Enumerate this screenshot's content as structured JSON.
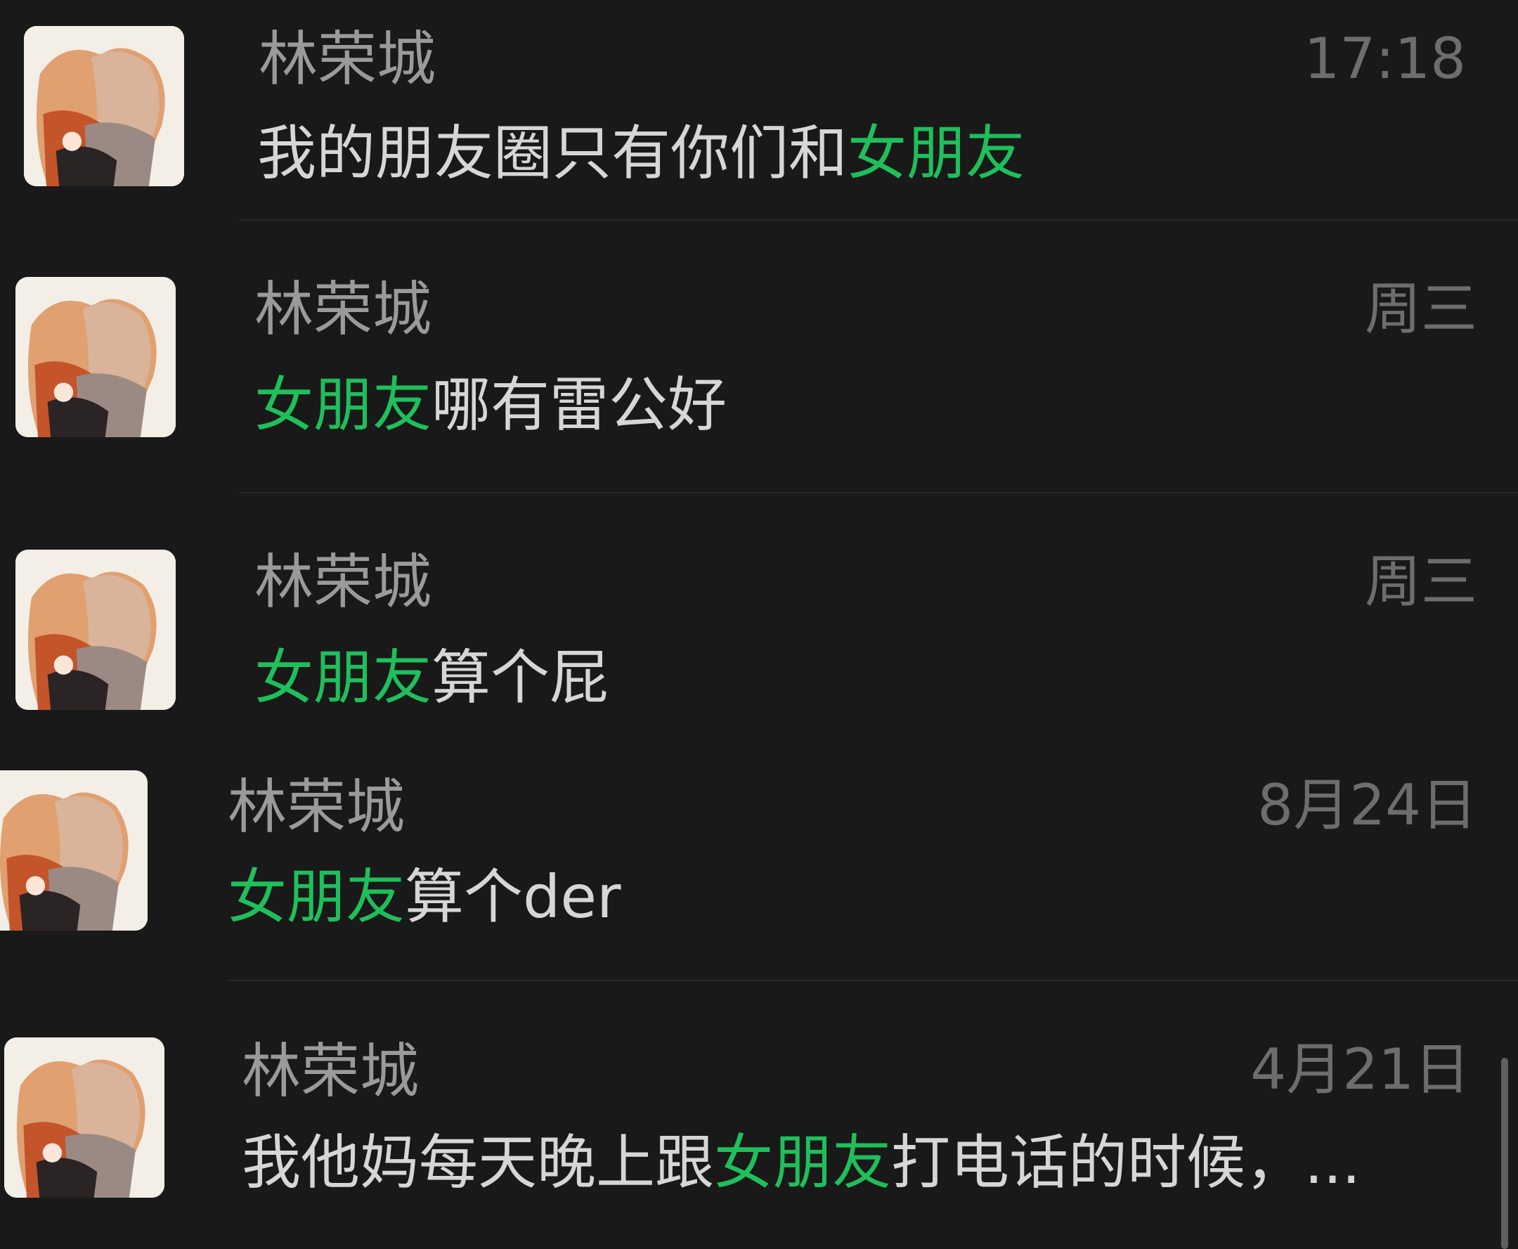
{
  "results": [
    {
      "name": "林荣城",
      "time": "17:18",
      "message": {
        "before": "我的朋友圈只有你们和",
        "highlight": "女朋友",
        "after": ""
      }
    },
    {
      "name": "林荣城",
      "time": "周三",
      "message": {
        "before": "",
        "highlight": "女朋友",
        "after": "哪有雷公好"
      }
    },
    {
      "name": "林荣城",
      "time": "周三",
      "message": {
        "before": "",
        "highlight": "女朋友",
        "after": "算个屁"
      }
    },
    {
      "name": "林荣城",
      "time": "8月24日",
      "message": {
        "before": "",
        "highlight": "女朋友",
        "after": "算个der"
      }
    },
    {
      "name": "林荣城",
      "time": "4月21日",
      "message": {
        "before": "我他妈每天晚上跟",
        "highlight": "女朋友",
        "after": "打电话的时候，..."
      }
    }
  ],
  "colors": {
    "background": "#191919",
    "highlight": "#1fbf5b",
    "name": "#9a9a9a",
    "time": "#6d6d6d",
    "message": "#d6d6d6"
  },
  "icons": {
    "avatar": "contact-avatar-anime-hug"
  }
}
